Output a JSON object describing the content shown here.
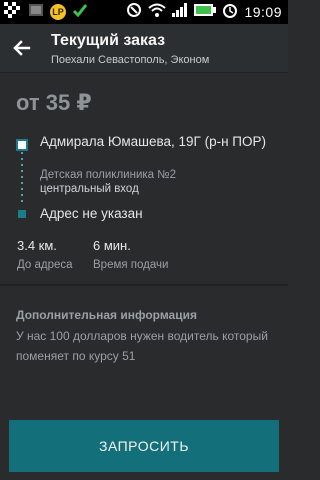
{
  "status_bar": {
    "time": "19:09",
    "left_icons": [
      "notification-pattern-icon",
      "gallery-icon",
      "lp-coin-icon",
      "check-icon"
    ],
    "right_icons": [
      "nfc-icon",
      "wifi-icon",
      "signal-icon",
      "battery-icon",
      "alarm-icon"
    ],
    "coin_text": "LP"
  },
  "header": {
    "title": "Текущий заказ",
    "subtitle": "Поехали Севастополь, Эконом"
  },
  "order": {
    "price": "от 35 ₽",
    "from_address": "Адмирала Юмашева, 19Г (р-н ПОР)",
    "from_note": "Детская поликлиника №2",
    "from_entrance": "центральный вход",
    "to_address": "Адрес не указан"
  },
  "stats": {
    "distance_value": "3.4 км.",
    "distance_label": "До адреса",
    "time_value": "6 мин.",
    "time_label": "Время подачи"
  },
  "info": {
    "title": "Дополнительная информация",
    "text": "У нас 100 долларов нужен водитель который поменяет по курсу 51"
  },
  "actions": {
    "request_label": "ЗАПРОСИТЬ"
  },
  "colors": {
    "accent": "#13707b",
    "background": "#2a2b2d",
    "muted_text": "#9aa0a3"
  }
}
